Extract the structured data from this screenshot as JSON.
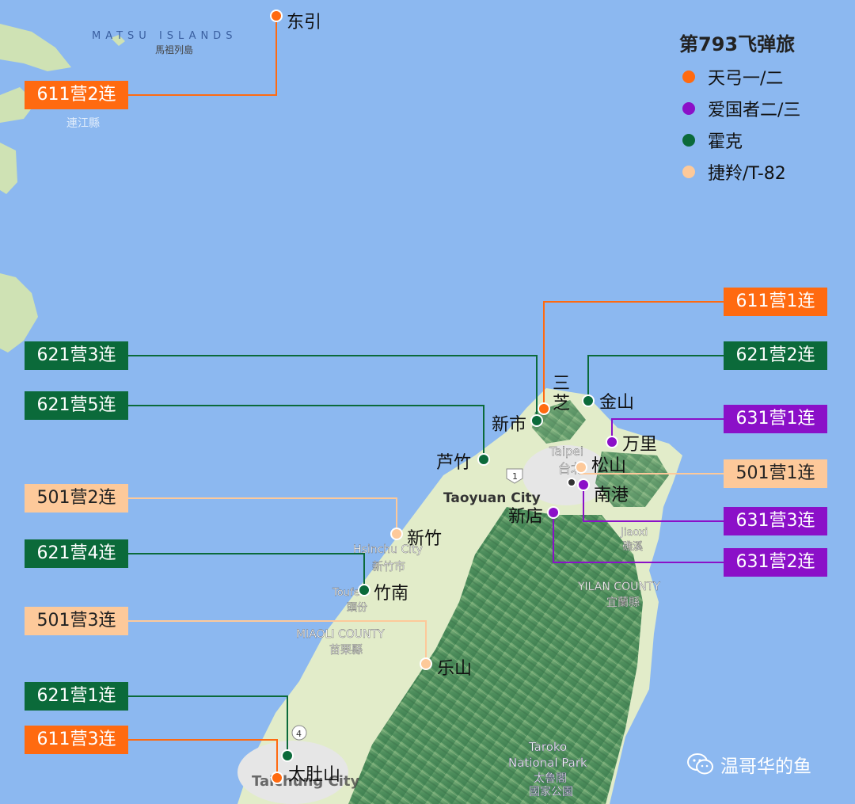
{
  "legend": {
    "title": "第793飞弹旅",
    "items": [
      {
        "label": "天弓一/二",
        "color": "#ff6a10"
      },
      {
        "label": "爱国者二/三",
        "color": "#8b10c8"
      },
      {
        "label": "霍克",
        "color": "#0b6a3a"
      },
      {
        "label": "捷羚/T-82",
        "color": "#fdc99a"
      }
    ]
  },
  "units": [
    {
      "label": "611营2连",
      "site": "东引",
      "system": "天弓一/二"
    },
    {
      "label": "611营1连",
      "site": "三芝",
      "system": "天弓一/二"
    },
    {
      "label": "621营3连",
      "site": "新市",
      "system": "霍克"
    },
    {
      "label": "621营2连",
      "site": "金山",
      "system": "霍克"
    },
    {
      "label": "621营5连",
      "site": "芦竹",
      "system": "霍克"
    },
    {
      "label": "631营1连",
      "site": "万里",
      "system": "爱国者二/三"
    },
    {
      "label": "501营1连",
      "site": "松山",
      "system": "捷羚/T-82"
    },
    {
      "label": "501营2连",
      "site": "新竹",
      "system": "捷羚/T-82"
    },
    {
      "label": "631营3连",
      "site": "南港",
      "system": "爱国者二/三"
    },
    {
      "label": "631营2连",
      "site": "新店",
      "system": "爱国者二/三"
    },
    {
      "label": "621营4连",
      "site": "竹南",
      "system": "霍克"
    },
    {
      "label": "501营3连",
      "site": "乐山",
      "system": "捷羚/T-82"
    },
    {
      "label": "621营1连",
      "site": "太肚山",
      "system": "霍克"
    },
    {
      "label": "611营3连",
      "site": "太肚山",
      "system": "天弓一/二"
    }
  ],
  "basemap_labels": {
    "matsu_en": "MATSU ISLANDS",
    "matsu_zh": "馬祖列島",
    "lienchiang": "連江縣",
    "taipei_en": "Taipei",
    "taipei_zh": "台北",
    "taoyuan": "Taoyuan City",
    "hsinchu_en": "Hsinchu City",
    "hsinchu_zh": "新竹市",
    "toufen_en": "Toufe",
    "toufen_zh": "頭份",
    "miaoli_en": "MIAOLI COUNTY",
    "miaoli_zh": "苗栗縣",
    "jiaoxi_en": "Jiaoxi",
    "jiaoxi_zh": "礁溪",
    "yilan_en": "YILAN COUNTY",
    "yilan_zh": "宜蘭縣",
    "taroko_en1": "Taroko",
    "taroko_en2": "National Park",
    "taroko_zh1": "太魯閣",
    "taroko_zh2": "國家公園",
    "taichung": "Taichung City",
    "road_1": "1",
    "road_4": "4"
  },
  "watermark": "温哥华的鱼",
  "colors": {
    "sea": "#8cb8f0",
    "land_lowland": "#dde9c4",
    "land_mountain": "#5f9e6a",
    "urban": "#e6e6e6"
  }
}
